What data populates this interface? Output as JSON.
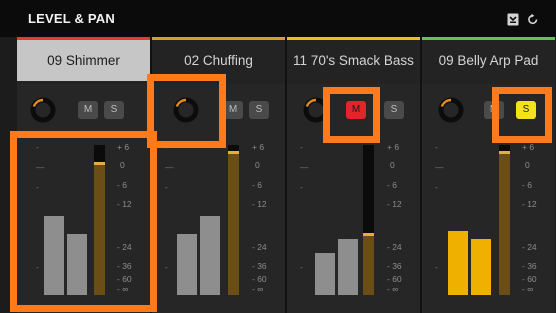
{
  "header": {
    "title": "LEVEL & PAN",
    "icons": [
      "collapse-icon",
      "reset-icon"
    ]
  },
  "strips": [
    {
      "name": "09 Shimmer",
      "selected": true,
      "accent": "#e33b2e",
      "mute_label": "M",
      "solo_label": "S",
      "mute_on": false,
      "solo_on": false,
      "meter_color": "#8e8e8e",
      "meter_left_level": 0.52,
      "meter_right_level": 0.4,
      "fader_level": 0.87
    },
    {
      "name": "02 Chuffing",
      "selected": false,
      "accent": "#e09a2a",
      "mute_label": "M",
      "solo_label": "S",
      "mute_on": false,
      "solo_on": false,
      "meter_color": "#8e8e8e",
      "meter_left_level": 0.42,
      "meter_right_level": 0.52,
      "fader_level": 0.95
    },
    {
      "name": "11 70's Smack Bass",
      "selected": false,
      "accent": "#e6c21f",
      "mute_label": "M",
      "solo_label": "S",
      "mute_on": true,
      "solo_on": false,
      "meter_color": "#8e8e8e",
      "meter_left_level": 0.27,
      "meter_right_level": 0.38,
      "fader_level": 0.4
    },
    {
      "name": "09 Belly Arp Pad",
      "selected": false,
      "accent": "#59c94a",
      "mute_label": "M",
      "solo_label": "S",
      "mute_on": false,
      "solo_on": true,
      "meter_color": "#f0b000",
      "meter_left_level": 0.47,
      "meter_right_level": 0.41,
      "fader_level": 0.95
    }
  ],
  "scale": {
    "ticks": [
      "+ 6",
      "0",
      "- 6",
      "- 12",
      "- 24",
      "- 36",
      "- 60",
      "- ∞"
    ]
  },
  "colors": {
    "highlight": "#ff7a1a",
    "knob_arc": "#e08a1f"
  }
}
